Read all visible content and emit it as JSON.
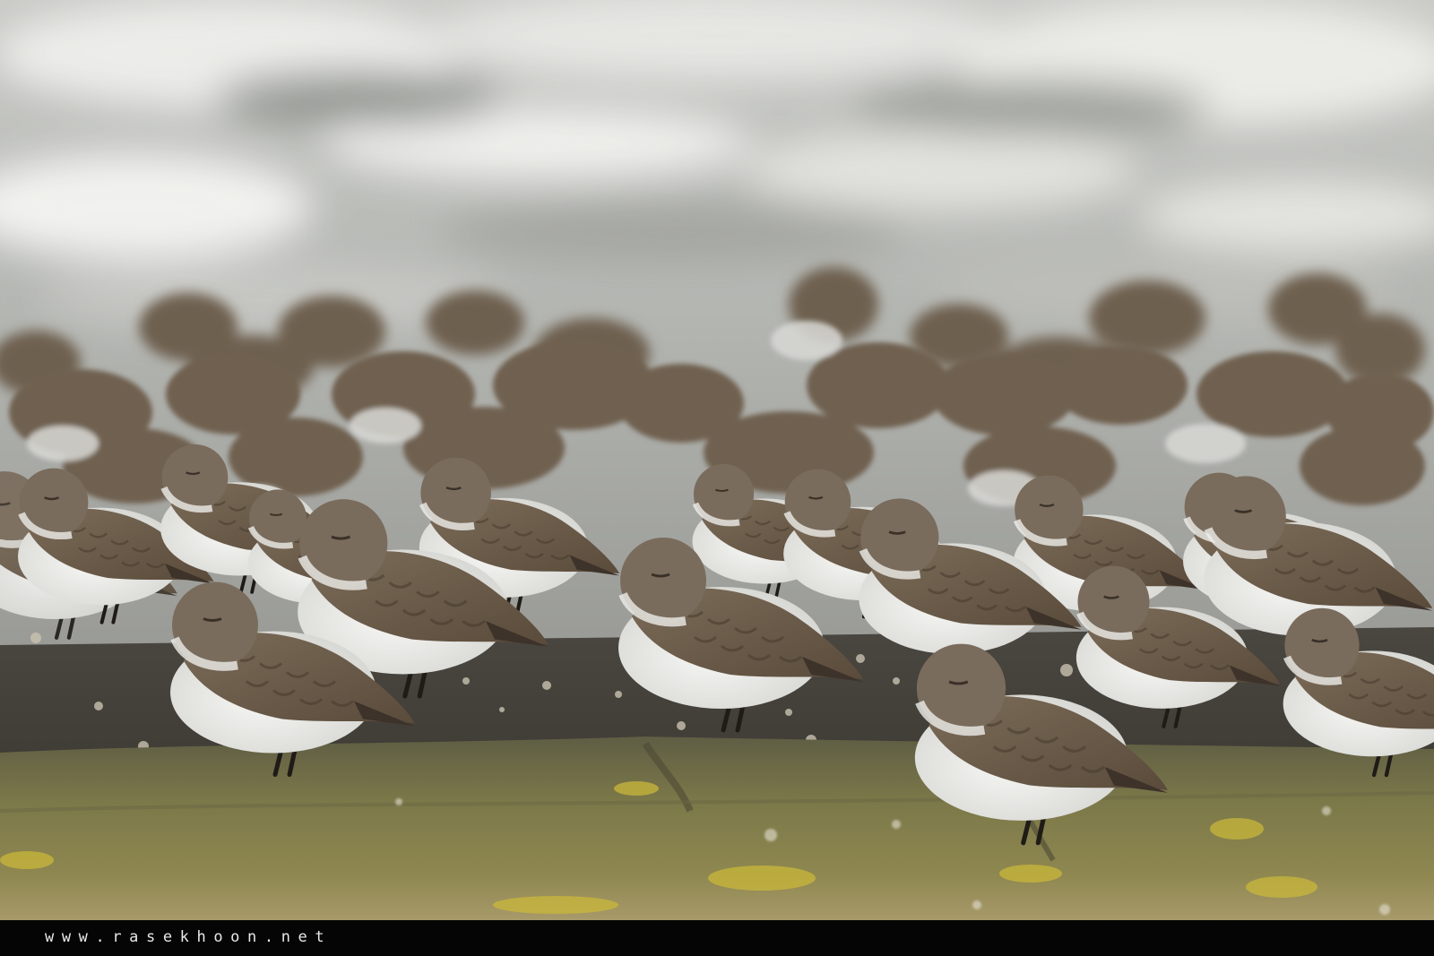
{
  "image": {
    "subject": "flock of small shorebirds resting on a mossy stone sea wall",
    "colors": {
      "surf": "#dcdcd8",
      "sea": "#8b8e88",
      "plumage": "#6b5c4b",
      "belly": "#eeeeec",
      "wall_moss": "#8a8645",
      "lichen": "#c9b73a"
    }
  },
  "watermark": {
    "text": "www.rasekhoon.net"
  }
}
